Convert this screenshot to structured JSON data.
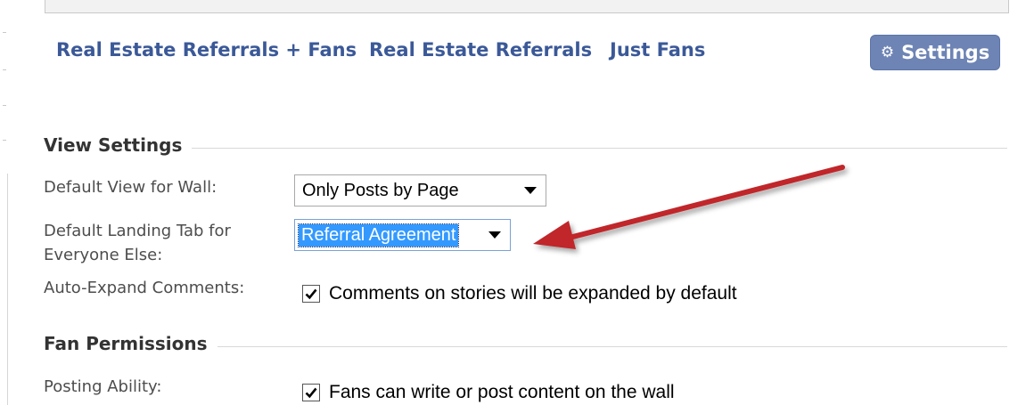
{
  "tabs": [
    {
      "label": "Real Estate Referrals + Fans"
    },
    {
      "label": "Real Estate Referrals"
    },
    {
      "label": "Just Fans"
    }
  ],
  "settings_button": {
    "label": "Settings",
    "icon": "gear-icon"
  },
  "view_settings": {
    "title": "View Settings",
    "default_view_wall": {
      "label": "Default View for Wall:",
      "value": "Only Posts by Page"
    },
    "default_landing_tab": {
      "label_line1": "Default Landing Tab for",
      "label_line2": "Everyone Else:",
      "value": "Referral Agreement"
    },
    "auto_expand": {
      "label": "Auto-Expand Comments:",
      "checked": true,
      "text": "Comments on stories will be expanded by default"
    }
  },
  "fan_permissions": {
    "title": "Fan Permissions",
    "posting_ability": {
      "label": "Posting Ability:",
      "checked": true,
      "text": "Fans can write or post content on the wall"
    }
  },
  "colors": {
    "link": "#3b5998",
    "button": "#6d84b4",
    "annotation_arrow": "#c0282b"
  }
}
